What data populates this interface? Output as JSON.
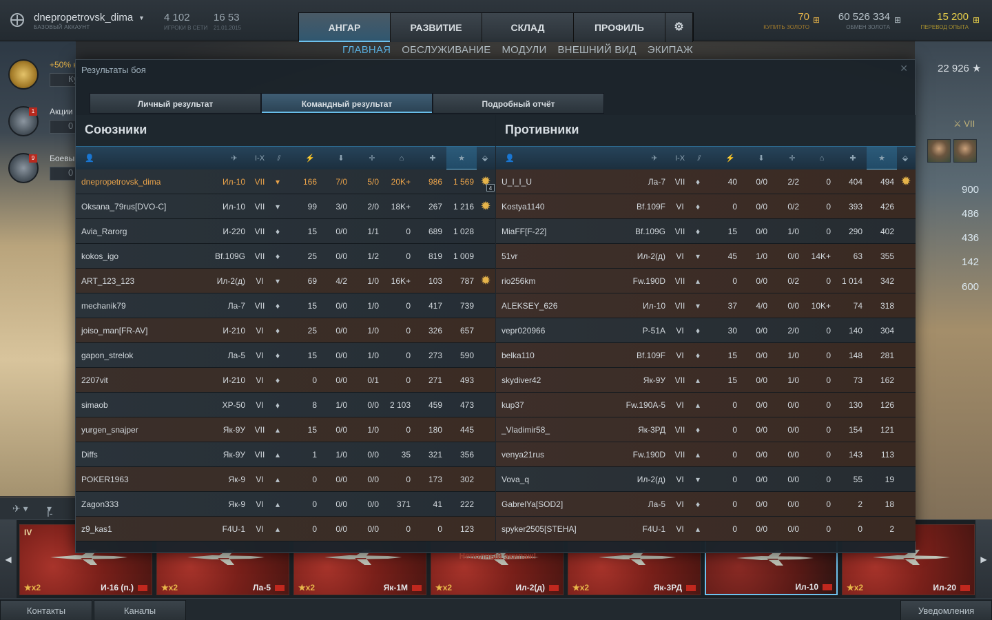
{
  "account": {
    "name": "dnepropetrovsk_dima",
    "type": "БАЗОВЫЙ АККАУНТ",
    "online_value": "4 102",
    "online_label": "ИГРОКИ В СЕТИ",
    "time_value": "16 53",
    "date_label": "21.01.2015"
  },
  "main_tabs": [
    "АНГАР",
    "РАЗВИТИЕ",
    "СКЛАД",
    "ПРОФИЛЬ"
  ],
  "currency": {
    "gold": "70",
    "gold_label": "КУПИТЬ ЗОЛОТО",
    "credits": "60 526 334",
    "credits_label": "ОБМЕН ЗОЛОТА",
    "xp": "15 200",
    "xp_label": "ПЕРЕВОД ОПЫТА"
  },
  "subnav": [
    "ГЛАВНАЯ",
    "ОБСЛУЖИВАНИЕ",
    "МОДУЛИ",
    "ВНЕШНИЙ ВИД",
    "ЭКИПАЖ"
  ],
  "left_widgets": {
    "bonus": "+50% к",
    "bonus_box": "Ку",
    "promo": "Акции",
    "promo_box": "0",
    "promo_badge": "1",
    "battle": "Боевы",
    "battle_box": "0",
    "battle_badge": "9"
  },
  "right_panel": {
    "total_xp": "22 926 ★",
    "tier": "VII",
    "values": [
      "900",
      "486",
      "436",
      "142",
      "600"
    ]
  },
  "dialog": {
    "title": "Результаты боя",
    "tabs": [
      "Личный результат",
      "Командный результат",
      "Подробный отчёт"
    ],
    "allies_title": "Союзники",
    "enemies_title": "Противники",
    "tier_col": "I-X"
  },
  "allies": [
    {
      "name": "dnepropetrovsk_dima",
      "plane": "Ил-10",
      "tier": "VII",
      "type": "▾",
      "dmg": "166",
      "a": "7/0",
      "b": "5/0",
      "c": "20K+",
      "xp": "986",
      "score": "1 569",
      "medal": "4"
    },
    {
      "name": "Oksana_79rus[DVO-C]",
      "plane": "Ил-10",
      "tier": "VII",
      "type": "▾",
      "dmg": "99",
      "a": "3/0",
      "b": "2/0",
      "c": "18K+",
      "xp": "267",
      "score": "1 216",
      "medal": ""
    },
    {
      "name": "Avia_Rarorg",
      "plane": "И-220",
      "tier": "VII",
      "type": "♦",
      "dmg": "15",
      "a": "0/0",
      "b": "1/1",
      "c": "0",
      "xp": "689",
      "score": "1 028",
      "medal": null
    },
    {
      "name": "kokos_igo",
      "plane": "Bf.109G",
      "tier": "VII",
      "type": "♦",
      "dmg": "25",
      "a": "0/0",
      "b": "1/2",
      "c": "0",
      "xp": "819",
      "score": "1 009",
      "medal": null
    },
    {
      "name": "ART_123_123",
      "plane": "Ил-2(д)",
      "tier": "VI",
      "type": "▾",
      "dmg": "69",
      "a": "4/2",
      "b": "1/0",
      "c": "16K+",
      "xp": "103",
      "score": "787",
      "medal": ""
    },
    {
      "name": "mechanik79",
      "plane": "Ла-7",
      "tier": "VII",
      "type": "♦",
      "dmg": "15",
      "a": "0/0",
      "b": "1/0",
      "c": "0",
      "xp": "417",
      "score": "739",
      "medal": null
    },
    {
      "name": "joiso_man[FR-AV]",
      "plane": "И-210",
      "tier": "VI",
      "type": "♦",
      "dmg": "25",
      "a": "0/0",
      "b": "1/0",
      "c": "0",
      "xp": "326",
      "score": "657",
      "medal": null
    },
    {
      "name": "gapon_strelok",
      "plane": "Ла-5",
      "tier": "VI",
      "type": "♦",
      "dmg": "15",
      "a": "0/0",
      "b": "1/0",
      "c": "0",
      "xp": "273",
      "score": "590",
      "medal": null
    },
    {
      "name": "2207vit",
      "plane": "И-210",
      "tier": "VI",
      "type": "♦",
      "dmg": "0",
      "a": "0/0",
      "b": "0/1",
      "c": "0",
      "xp": "271",
      "score": "493",
      "medal": null
    },
    {
      "name": "simaob",
      "plane": "XP-50",
      "tier": "VI",
      "type": "⬧",
      "dmg": "8",
      "a": "1/0",
      "b": "0/0",
      "c": "2 103",
      "xp": "459",
      "score": "473",
      "medal": null
    },
    {
      "name": "yurgen_snajper",
      "plane": "Як-9У",
      "tier": "VII",
      "type": "▴",
      "dmg": "15",
      "a": "0/0",
      "b": "1/0",
      "c": "0",
      "xp": "180",
      "score": "445",
      "medal": null
    },
    {
      "name": "Diffs",
      "plane": "Як-9У",
      "tier": "VII",
      "type": "▴",
      "dmg": "1",
      "a": "1/0",
      "b": "0/0",
      "c": "35",
      "xp": "321",
      "score": "356",
      "medal": null
    },
    {
      "name": "POKER1963",
      "plane": "Як-9",
      "tier": "VI",
      "type": "▴",
      "dmg": "0",
      "a": "0/0",
      "b": "0/0",
      "c": "0",
      "xp": "173",
      "score": "302",
      "medal": null
    },
    {
      "name": "Zagon333",
      "plane": "Як-9",
      "tier": "VI",
      "type": "▴",
      "dmg": "0",
      "a": "0/0",
      "b": "0/0",
      "c": "371",
      "xp": "41",
      "score": "222",
      "medal": null
    },
    {
      "name": "z9_kas1",
      "plane": "F4U-1",
      "tier": "VI",
      "type": "▴",
      "dmg": "0",
      "a": "0/0",
      "b": "0/0",
      "c": "0",
      "xp": "0",
      "score": "123",
      "medal": null
    }
  ],
  "enemies": [
    {
      "name": "U_I_I_U",
      "plane": "Ла-7",
      "tier": "VII",
      "type": "♦",
      "dmg": "40",
      "a": "0/0",
      "b": "2/2",
      "c": "0",
      "xp": "404",
      "score": "494",
      "medal": ""
    },
    {
      "name": "Kostya1140",
      "plane": "Bf.109F",
      "tier": "VI",
      "type": "♦",
      "dmg": "0",
      "a": "0/0",
      "b": "0/2",
      "c": "0",
      "xp": "393",
      "score": "426",
      "medal": null
    },
    {
      "name": "MiaFF[F-22]",
      "plane": "Bf.109G",
      "tier": "VII",
      "type": "♦",
      "dmg": "15",
      "a": "0/0",
      "b": "1/0",
      "c": "0",
      "xp": "290",
      "score": "402",
      "medal": null
    },
    {
      "name": "51vr",
      "plane": "Ил-2(д)",
      "tier": "VI",
      "type": "▾",
      "dmg": "45",
      "a": "1/0",
      "b": "0/0",
      "c": "14K+",
      "xp": "63",
      "score": "355",
      "medal": null
    },
    {
      "name": "rio256km",
      "plane": "Fw.190D",
      "tier": "VII",
      "type": "▴",
      "dmg": "0",
      "a": "0/0",
      "b": "0/2",
      "c": "0",
      "xp": "1 014",
      "score": "342",
      "medal": null
    },
    {
      "name": "ALEKSEY_626",
      "plane": "Ил-10",
      "tier": "VII",
      "type": "▾",
      "dmg": "37",
      "a": "4/0",
      "b": "0/0",
      "c": "10K+",
      "xp": "74",
      "score": "318",
      "medal": null
    },
    {
      "name": "vepr020966",
      "plane": "P-51A",
      "tier": "VI",
      "type": "♦",
      "dmg": "30",
      "a": "0/0",
      "b": "2/0",
      "c": "0",
      "xp": "140",
      "score": "304",
      "medal": null
    },
    {
      "name": "belka110",
      "plane": "Bf.109F",
      "tier": "VI",
      "type": "♦",
      "dmg": "15",
      "a": "0/0",
      "b": "1/0",
      "c": "0",
      "xp": "148",
      "score": "281",
      "medal": null
    },
    {
      "name": "skydiver42",
      "plane": "Як-9У",
      "tier": "VII",
      "type": "▴",
      "dmg": "15",
      "a": "0/0",
      "b": "1/0",
      "c": "0",
      "xp": "73",
      "score": "162",
      "medal": null
    },
    {
      "name": "kup37",
      "plane": "Fw.190A-5",
      "tier": "VI",
      "type": "▴",
      "dmg": "0",
      "a": "0/0",
      "b": "0/0",
      "c": "0",
      "xp": "130",
      "score": "126",
      "medal": null
    },
    {
      "name": "_Vladimir58_",
      "plane": "Як-3РД",
      "tier": "VII",
      "type": "♦",
      "dmg": "0",
      "a": "0/0",
      "b": "0/0",
      "c": "0",
      "xp": "154",
      "score": "121",
      "medal": null
    },
    {
      "name": "venya21rus",
      "plane": "Fw.190D",
      "tier": "VII",
      "type": "▴",
      "dmg": "0",
      "a": "0/0",
      "b": "0/0",
      "c": "0",
      "xp": "143",
      "score": "113",
      "medal": null
    },
    {
      "name": "Vova_q",
      "plane": "Ил-2(д)",
      "tier": "VI",
      "type": "▾",
      "dmg": "0",
      "a": "0/0",
      "b": "0/0",
      "c": "0",
      "xp": "55",
      "score": "19",
      "medal": null
    },
    {
      "name": "GabrelYa[SOD2]",
      "plane": "Ла-5",
      "tier": "VI",
      "type": "♦",
      "dmg": "0",
      "a": "0/0",
      "b": "0/0",
      "c": "0",
      "xp": "2",
      "score": "18",
      "medal": null
    },
    {
      "name": "spyker2505[STEHA]",
      "plane": "F4U-1",
      "tier": "VI",
      "type": "▴",
      "dmg": "0",
      "a": "0/0",
      "b": "0/0",
      "c": "0",
      "xp": "0",
      "score": "2",
      "medal": null
    }
  ],
  "filterbar": {
    "tier": "I-X"
  },
  "carousel": [
    {
      "tier": "IV",
      "x2": "★x2",
      "name": "И-16 (п.)",
      "warn": ""
    },
    {
      "tier": "",
      "x2": "★x2",
      "name": "Ла-5",
      "warn": ""
    },
    {
      "tier": "",
      "x2": "★x2",
      "name": "Як-1М",
      "warn": ""
    },
    {
      "tier": "",
      "x2": "★x2",
      "name": "Ил-2(д)",
      "warn": "Неполный экипаж!"
    },
    {
      "tier": "",
      "x2": "★x2",
      "name": "Як-3РД",
      "warn": ""
    },
    {
      "tier": "",
      "x2": "",
      "name": "Ил-10",
      "warn": ""
    },
    {
      "tier": "",
      "x2": "★x2",
      "name": "Ил-20",
      "warn": ""
    }
  ],
  "footer": {
    "contacts": "Контакты",
    "channels": "Каналы",
    "notifications": "Уведомления"
  }
}
